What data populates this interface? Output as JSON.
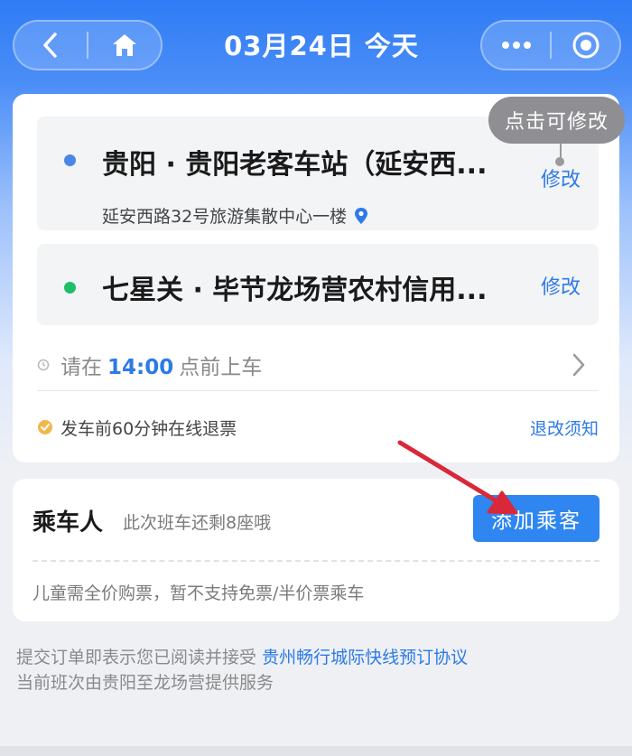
{
  "header": {
    "title": "03月24日 今天",
    "icons": [
      "back-icon",
      "home-icon",
      "more-icon",
      "target-icon"
    ]
  },
  "route": {
    "tooltip": "点击可修改",
    "departure": {
      "name": "贵阳 · 贵阳老客车站（延安西...",
      "address": "延安西路32号旅游集散中心一楼",
      "edit": "修改",
      "color": "#4a86e8"
    },
    "arrival": {
      "name": "七星关 · 毕节龙场营农村信用...",
      "edit": "修改",
      "color": "#1fbf6a"
    },
    "boarding": {
      "prefix": "请在",
      "time": "14:00",
      "suffix": "点前上车"
    },
    "refund": {
      "text": "发车前60分钟在线退票",
      "link": "退改须知"
    }
  },
  "passenger": {
    "title": "乘车人",
    "subtitle": "此次班车还剩8座哦",
    "add_button": "添加乘客",
    "note": "儿童需全价购票，暂不支持免票/半价票乘车"
  },
  "agreement": {
    "line1_prefix": "提交订单即表示您已阅读并接受",
    "line1_link": "贵州畅行城际快线预订协议",
    "line2": "当前班次由贵阳至龙场营提供服务"
  },
  "colors": {
    "accent": "#2e7ae6",
    "header": "#2f7cf6",
    "annotation_arrow": "#d8283a"
  }
}
